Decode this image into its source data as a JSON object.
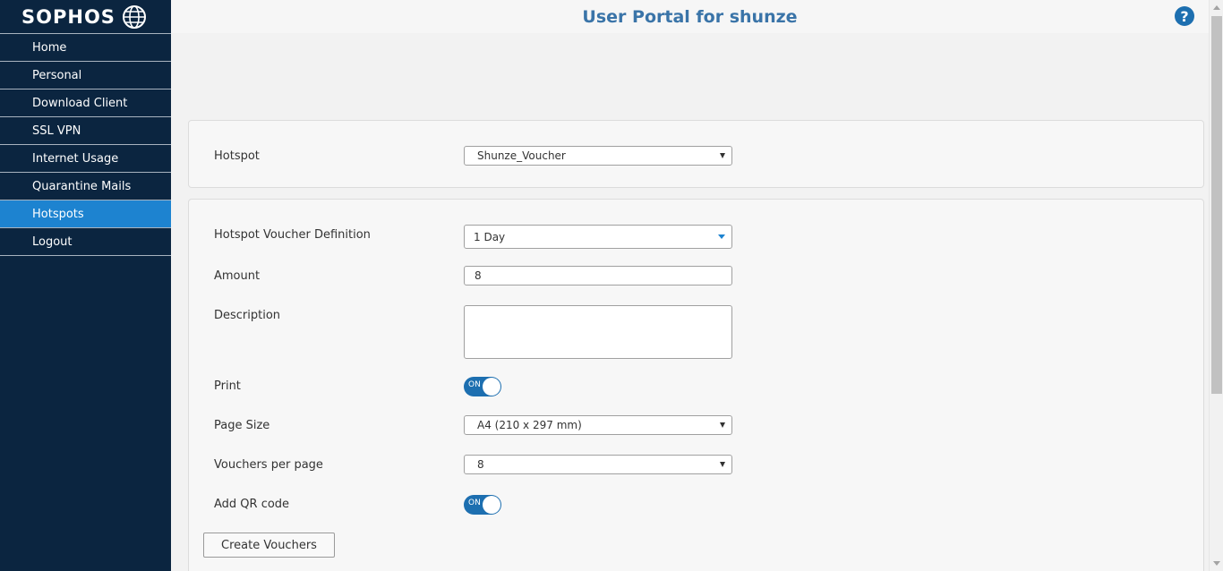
{
  "brand": {
    "name": "SOPHOS"
  },
  "header": {
    "title": "User Portal for shunze",
    "help_glyph": "?"
  },
  "sidebar": {
    "items": [
      {
        "label": "Home",
        "active": false
      },
      {
        "label": "Personal",
        "active": false
      },
      {
        "label": "Download Client",
        "active": false
      },
      {
        "label": "SSL VPN",
        "active": false
      },
      {
        "label": "Internet Usage",
        "active": false
      },
      {
        "label": "Quarantine Mails",
        "active": false
      },
      {
        "label": "Hotspots",
        "active": true
      },
      {
        "label": "Logout",
        "active": false
      }
    ]
  },
  "hotspot_panel": {
    "label": "Hotspot",
    "value": "Shunze_Voucher"
  },
  "voucher_panel": {
    "definition_label": "Hotspot Voucher Definition",
    "definition_value": "1 Day",
    "amount_label": "Amount",
    "amount_value": "8",
    "description_label": "Description",
    "description_value": "",
    "print_label": "Print",
    "print_state": "ON",
    "page_size_label": "Page Size",
    "page_size_value": "A4 (210 x 297 mm)",
    "per_page_label": "Vouchers per page",
    "per_page_value": "8",
    "qr_label": "Add QR code",
    "qr_state": "ON",
    "create_button": "Create Vouchers"
  },
  "colors": {
    "sidebar_bg": "#0b2540",
    "active_item": "#1d83d0",
    "title": "#3a74a8",
    "toggle": "#1d6fb0"
  }
}
